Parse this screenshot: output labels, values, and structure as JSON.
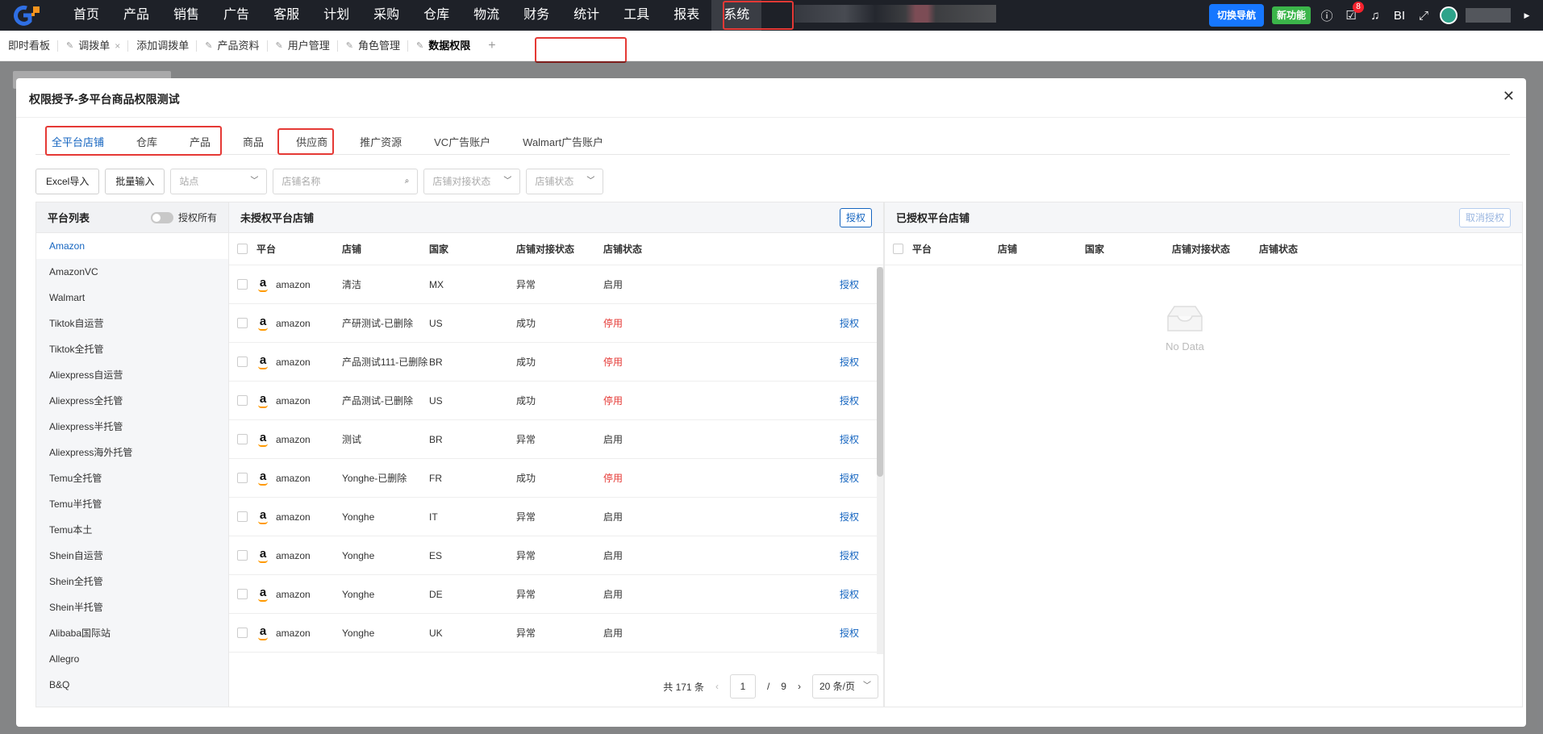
{
  "topnav": {
    "items": [
      "首页",
      "产品",
      "销售",
      "广告",
      "客服",
      "计划",
      "采购",
      "仓库",
      "物流",
      "财务",
      "统计",
      "工具",
      "报表",
      "系统"
    ],
    "switch_label": "切换导航",
    "new_label": "新功能",
    "bi_label": "BI",
    "badge_count": "8"
  },
  "page_tabs": [
    {
      "label": "即时看板",
      "pinned": false,
      "closable": false
    },
    {
      "label": "调拨单",
      "pinned": true,
      "closable": true
    },
    {
      "label": "添加调拨单",
      "pinned": false,
      "closable": false
    },
    {
      "label": "产品资料",
      "pinned": true,
      "closable": false
    },
    {
      "label": "用户管理",
      "pinned": true,
      "closable": false
    },
    {
      "label": "角色管理",
      "pinned": true,
      "closable": false
    },
    {
      "label": "数据权限",
      "pinned": true,
      "closable": false,
      "active": true
    }
  ],
  "modal": {
    "title": "权限授予-多平台商品权限测试",
    "perm_tabs": [
      "全平台店铺",
      "仓库",
      "产品",
      "商品",
      "供应商",
      "推广资源",
      "VC广告账户",
      "Walmart广告账户"
    ],
    "filters": {
      "excel_import": "Excel导入",
      "bulk_input": "批量输入",
      "site_placeholder": "站点",
      "shop_name_placeholder": "店铺名称",
      "dock_status_placeholder": "店铺对接状态",
      "shop_status_placeholder": "店铺状态"
    },
    "platform_panel": {
      "title": "平台列表",
      "toggle_label": "授权所有",
      "items": [
        "Amazon",
        "AmazonVC",
        "Walmart",
        "Tiktok自运营",
        "Tiktok全托管",
        "Aliexpress自运营",
        "Aliexpress全托管",
        "Aliexpress半托管",
        "Aliexpress海外托管",
        "Temu全托管",
        "Temu半托管",
        "Temu本土",
        "Shein自运营",
        "Shein全托管",
        "Shein半托管",
        "Alibaba国际站",
        "Allegro",
        "B&Q"
      ]
    },
    "unauth": {
      "title": "未授权平台店铺",
      "auth_button": "授权",
      "columns": [
        "平台",
        "店铺",
        "国家",
        "店铺对接状态",
        "店铺状态"
      ],
      "rows": [
        {
          "platform": "amazon",
          "shop": "清洁",
          "country": "MX",
          "dock": "异常",
          "status": "启用",
          "action": "授权"
        },
        {
          "platform": "amazon",
          "shop": "产研测试-已删除",
          "country": "US",
          "dock": "成功",
          "status": "停用",
          "action": "授权"
        },
        {
          "platform": "amazon",
          "shop": "产品测试111-已删除",
          "country": "BR",
          "dock": "成功",
          "status": "停用",
          "action": "授权"
        },
        {
          "platform": "amazon",
          "shop": "产品测试-已删除",
          "country": "US",
          "dock": "成功",
          "status": "停用",
          "action": "授权"
        },
        {
          "platform": "amazon",
          "shop": "测试",
          "country": "BR",
          "dock": "异常",
          "status": "启用",
          "action": "授权"
        },
        {
          "platform": "amazon",
          "shop": "Yonghe-已删除",
          "country": "FR",
          "dock": "成功",
          "status": "停用",
          "action": "授权"
        },
        {
          "platform": "amazon",
          "shop": "Yonghe",
          "country": "IT",
          "dock": "异常",
          "status": "启用",
          "action": "授权"
        },
        {
          "platform": "amazon",
          "shop": "Yonghe",
          "country": "ES",
          "dock": "异常",
          "status": "启用",
          "action": "授权"
        },
        {
          "platform": "amazon",
          "shop": "Yonghe",
          "country": "DE",
          "dock": "异常",
          "status": "启用",
          "action": "授权"
        },
        {
          "platform": "amazon",
          "shop": "Yonghe",
          "country": "UK",
          "dock": "异常",
          "status": "启用",
          "action": "授权"
        }
      ],
      "pager": {
        "total": "共 171 条",
        "current": "1",
        "sep": "/",
        "pages": "9",
        "page_size": "20 条/页"
      }
    },
    "auth": {
      "title": "已授权平台店铺",
      "cancel_button": "取消授权",
      "columns": [
        "平台",
        "店铺",
        "国家",
        "店铺对接状态",
        "店铺状态"
      ],
      "empty_text": "No Data"
    }
  },
  "colors": {
    "accent": "#1565c0",
    "danger": "#e53935",
    "nav_bg": "#1e2128",
    "highlight": "#e53935"
  }
}
